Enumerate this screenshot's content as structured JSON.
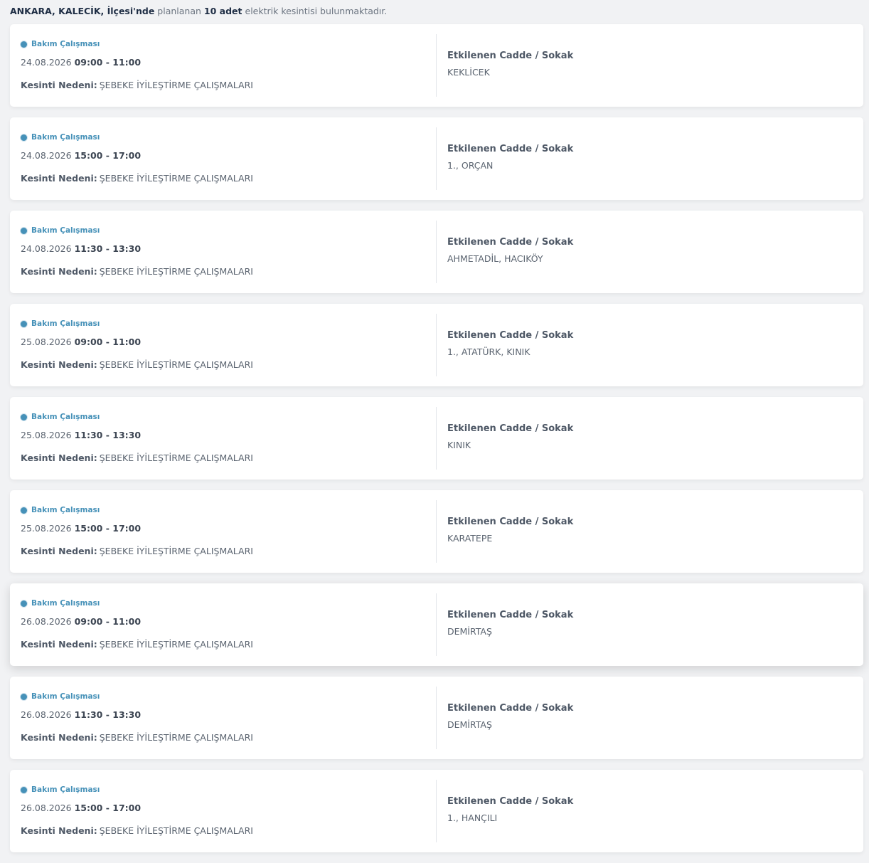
{
  "summary": {
    "location": "ANKARA, KALECİK, İlçesi'nde",
    "planned": "planlanan",
    "count": "10 adet",
    "suffix": "elektrik kesintisi bulunmaktadır."
  },
  "labels": {
    "reason_label": "Kesinti Nedeni:",
    "street_title": "Etkilenen Cadde / Sokak"
  },
  "colors": {
    "accent": "#4691b8",
    "heading": "#1f2e45",
    "text": "#5b6470",
    "background": "#f1f2f4",
    "card": "#ffffff"
  },
  "outages": [
    {
      "type": "Bakım Çalışması",
      "date": "24.08.2026",
      "hours": "09:00 - 11:00",
      "reason": "ŞEBEKE İYİLEŞTİRME ÇALIŞMALARI",
      "streets": "KEKLİCEK"
    },
    {
      "type": "Bakım Çalışması",
      "date": "24.08.2026",
      "hours": "15:00 - 17:00",
      "reason": "ŞEBEKE İYİLEŞTİRME ÇALIŞMALARI",
      "streets": "1., ORÇAN"
    },
    {
      "type": "Bakım Çalışması",
      "date": "24.08.2026",
      "hours": "11:30 - 13:30",
      "reason": "ŞEBEKE İYİLEŞTİRME ÇALIŞMALARI",
      "streets": "AHMETADİL, HACIKÖY"
    },
    {
      "type": "Bakım Çalışması",
      "date": "25.08.2026",
      "hours": "09:00 - 11:00",
      "reason": "ŞEBEKE İYİLEŞTİRME ÇALIŞMALARI",
      "streets": "1., ATATÜRK, KINIK"
    },
    {
      "type": "Bakım Çalışması",
      "date": "25.08.2026",
      "hours": "11:30 - 13:30",
      "reason": "ŞEBEKE İYİLEŞTİRME ÇALIŞMALARI",
      "streets": "KINIK"
    },
    {
      "type": "Bakım Çalışması",
      "date": "25.08.2026",
      "hours": "15:00 - 17:00",
      "reason": "ŞEBEKE İYİLEŞTİRME ÇALIŞMALARI",
      "streets": "KARATEPE"
    },
    {
      "type": "Bakım Çalışması",
      "date": "26.08.2026",
      "hours": "09:00 - 11:00",
      "reason": "ŞEBEKE İYİLEŞTİRME ÇALIŞMALARI",
      "streets": "DEMİRTAŞ"
    },
    {
      "type": "Bakım Çalışması",
      "date": "26.08.2026",
      "hours": "11:30 - 13:30",
      "reason": "ŞEBEKE İYİLEŞTİRME ÇALIŞMALARI",
      "streets": "DEMİRTAŞ"
    },
    {
      "type": "Bakım Çalışması",
      "date": "26.08.2026",
      "hours": "15:00 - 17:00",
      "reason": "ŞEBEKE İYİLEŞTİRME ÇALIŞMALARI",
      "streets": "1., HANÇILI"
    }
  ]
}
